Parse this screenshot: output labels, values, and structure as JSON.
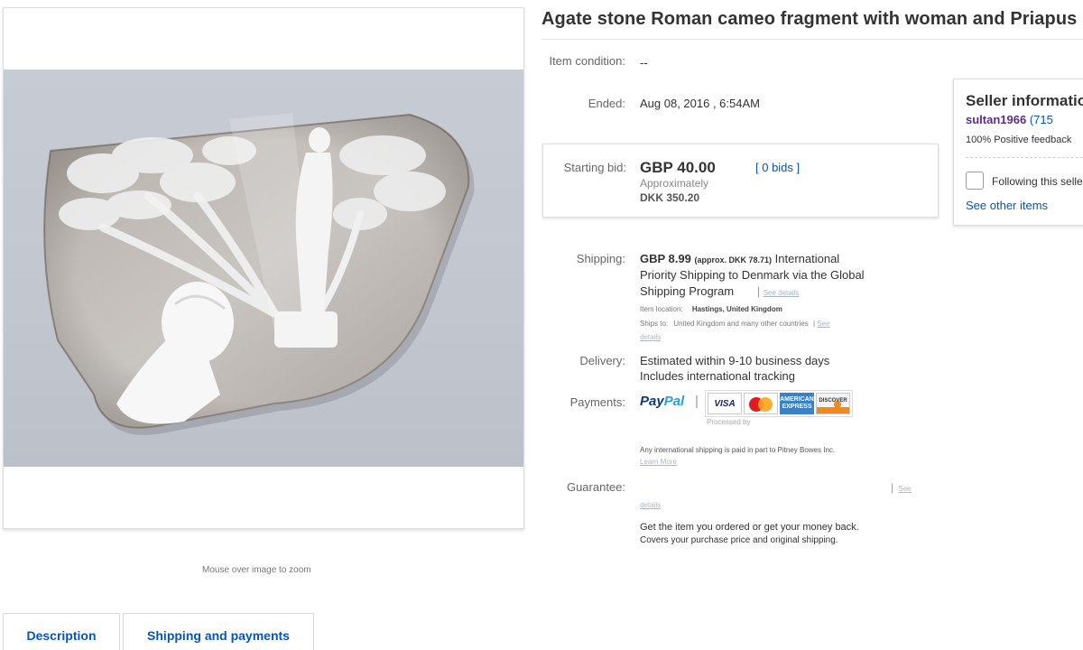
{
  "title": "Agate stone Roman cameo fragment with woman and Priapus",
  "image": {
    "zoom_hint": "Mouse over image to zoom"
  },
  "tabs": [
    {
      "label": "Description"
    },
    {
      "label": "Shipping and payments"
    }
  ],
  "details": {
    "condition": {
      "label": "Item condition:",
      "value": "--"
    },
    "ended": {
      "label": "Ended:",
      "value": "Aug 08, 2016 , 6:54AM"
    },
    "bid": {
      "label": "Starting bid:",
      "price": "GBP 40.00",
      "approx_label": "Approximately",
      "approx_value": "DKK 350.20",
      "bids": "[ 0 bids ]"
    },
    "shipping": {
      "label": "Shipping:",
      "price": "GBP 8.99",
      "approx": "(approx. DKK 78.71)",
      "line1_rest": "International",
      "line2": "Priority Shipping to Denmark  via the Global",
      "line3": "Shipping Program",
      "see_details": "See details",
      "item_location_label": "Item location:",
      "item_location": "Hastings, United Kingdom",
      "ships_to_label": "Ships to:",
      "ships_to": "United Kingdom and many other countries",
      "ships_see": "See",
      "ships_details": "details"
    },
    "delivery": {
      "label": "Delivery:",
      "line1": "Estimated within 9-10 business days",
      "line2": "Includes international tracking"
    },
    "payments": {
      "label": "Payments:",
      "paypal_pay": "Pay",
      "paypal_pal": "Pal",
      "processed_by": "Processed by",
      "cards": {
        "visa": "VISA",
        "amex": "AMERICAN EXPRESS",
        "discover": "DISCOVER"
      },
      "intl_note": "Any international shipping is paid in part to Pitney Bowes Inc.",
      "learn_more": "Learn More"
    },
    "guarantee": {
      "label": "Guarantee:",
      "see": "See",
      "details": "details",
      "line1": "Get the item you ordered or get your money back.",
      "line2": "Covers your purchase price and original shipping."
    }
  },
  "seller": {
    "title": "Seller information",
    "name": "sultan1966",
    "feedback_count": "(715",
    "feedback": "100% Positive feedback",
    "follow": "Following this seller",
    "see_other": "See other items"
  },
  "colors": {
    "link": "#0654ba",
    "seller_name": "#5c2d91",
    "photo_background": "#c5c9d1"
  }
}
